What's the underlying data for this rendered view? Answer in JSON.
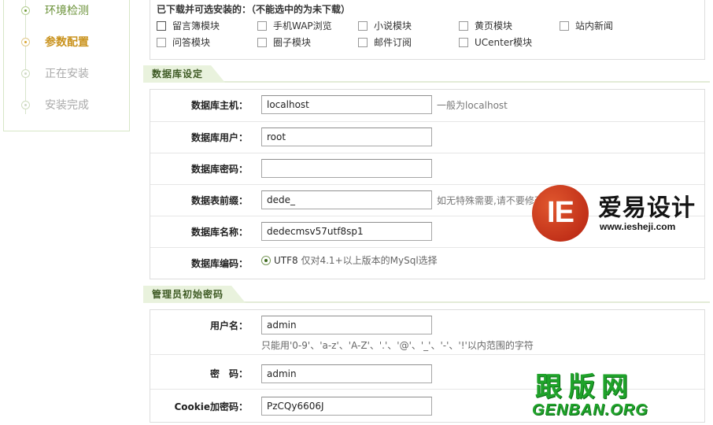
{
  "steps": [
    {
      "label": "环境检测",
      "state": "done"
    },
    {
      "label": "参数配置",
      "state": "active"
    },
    {
      "label": "正在安装",
      "state": "pending"
    },
    {
      "label": "安装完成",
      "state": "pending"
    }
  ],
  "modules": {
    "title": "已下载并可选安装的：（不能选中的为未下载）",
    "items": [
      {
        "label": "留言簿模块",
        "checked": false
      },
      {
        "label": "手机WAP浏览",
        "checked": false
      },
      {
        "label": "小说模块",
        "checked": false
      },
      {
        "label": "黄页模块",
        "checked": false
      },
      {
        "label": "站内新闻",
        "checked": false
      },
      {
        "label": "问答模块",
        "checked": false
      },
      {
        "label": "圈子模块",
        "checked": false
      },
      {
        "label": "邮件订阅",
        "checked": false
      },
      {
        "label": "UCenter模块",
        "checked": false
      }
    ]
  },
  "database": {
    "section_title": "数据库设定",
    "host_label": "数据库主机：",
    "host_value": "localhost",
    "host_hint": "一般为localhost",
    "user_label": "数据库用户：",
    "user_value": "root",
    "password_label": "数据库密码：",
    "password_value": "",
    "prefix_label": "数据表前缀：",
    "prefix_value": "dede_",
    "prefix_hint": "如无特殊需要,请不要修改",
    "name_label": "数据库名称：",
    "name_value": "dedecmsv57utf8sp1",
    "encoding_label": "数据库编码：",
    "encoding_option": "UTF8",
    "encoding_hint": "仅对4.1+以上版本的MySql选择"
  },
  "admin": {
    "section_title": "管理员初始密码",
    "username_label": "用户名：",
    "username_value": "admin",
    "username_hint": "只能用'0-9'、'a-z'、'A-Z'、'.'、'@'、'_'、'-'、'!'以内范围的字符",
    "password_label": "密　码：",
    "password_value": "admin",
    "cookie_label": "Cookie加密码：",
    "cookie_value": "PzCQy6606J"
  },
  "watermarks": {
    "ieshe_letters": "IE",
    "ieshe_cn": "爱易设计",
    "ieshe_url": "www.iesheji.com",
    "genban_cn": "跟版网",
    "genban_en": "GENBAN.ORG"
  }
}
